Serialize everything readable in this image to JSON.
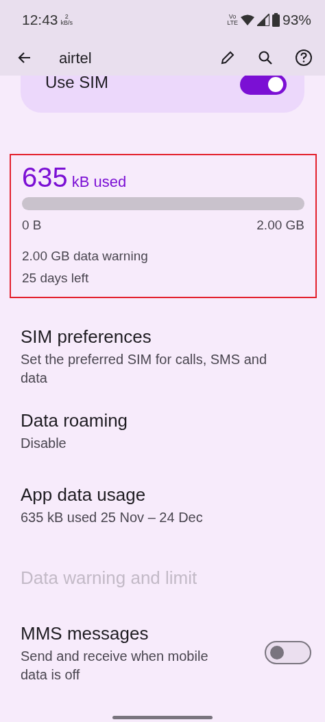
{
  "status_bar": {
    "time": "12:43",
    "speed_value": "2",
    "speed_unit": "kB/s",
    "network_badge_top": "Vo",
    "network_badge_bottom": "LTE",
    "battery": "93%"
  },
  "app_bar": {
    "title": "airtel"
  },
  "use_sim": {
    "label": "Use SIM",
    "on": true
  },
  "usage": {
    "highlighted": true,
    "amount": "635",
    "unit": "kB used",
    "level": 0.0,
    "min_label": "0 B",
    "max_label": "2.00 GB",
    "warning": "2.00 GB data warning",
    "days_left": "25 days left"
  },
  "settings": [
    {
      "kind": "text",
      "title": "SIM preferences",
      "subtitle": "Set the preferred SIM for calls, SMS and data",
      "disabled": false
    },
    {
      "kind": "text",
      "title": "Data roaming",
      "subtitle": "Disable",
      "disabled": false
    },
    {
      "kind": "text",
      "title": "App data usage",
      "subtitle": "635 kB used 25 Nov – 24 Dec",
      "disabled": false
    },
    {
      "kind": "text",
      "title": "Data warning and limit",
      "disabled": true
    },
    {
      "kind": "switch",
      "title": "MMS messages",
      "subtitle": "Send and receive when mobile data is off",
      "disabled": false,
      "on": false
    }
  ]
}
